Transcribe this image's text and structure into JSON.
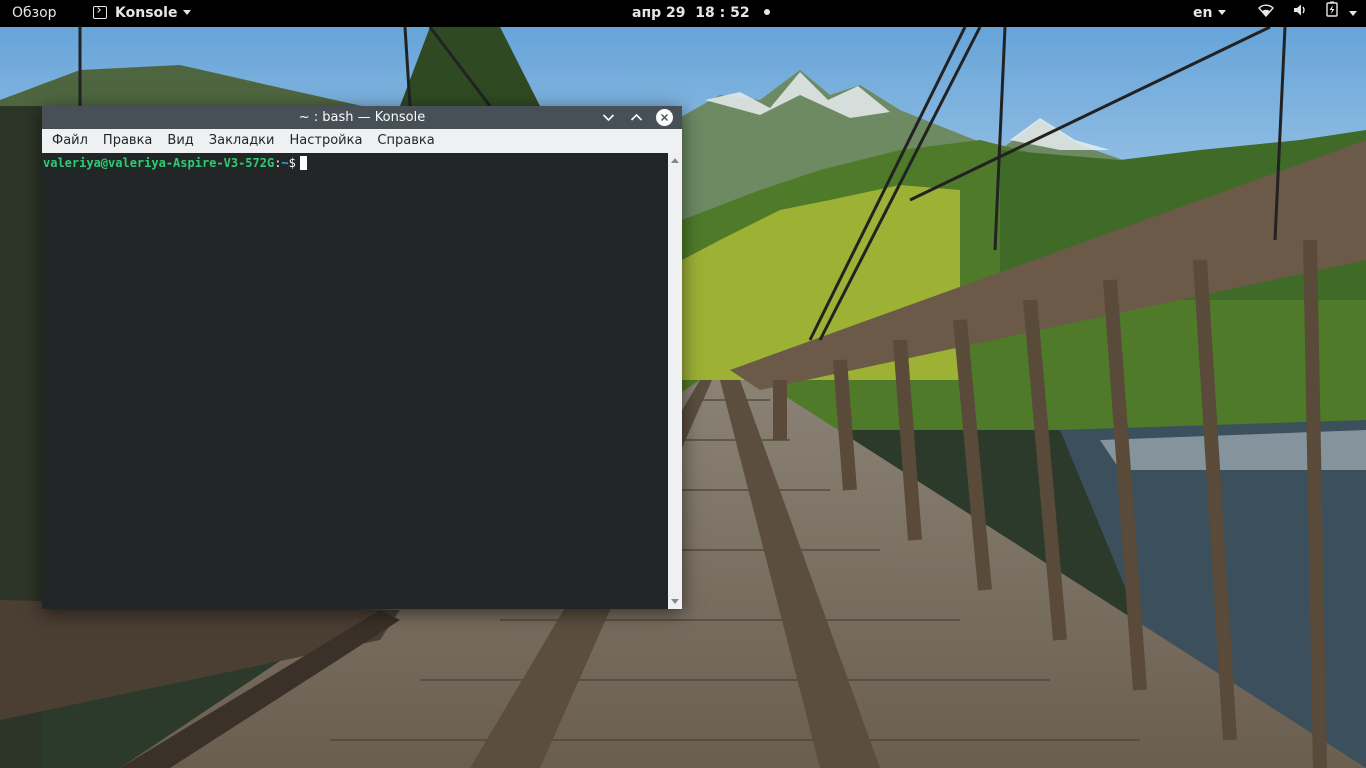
{
  "topbar": {
    "activities": "Обзор",
    "app_name": "Konsole",
    "clock": "апр 29  18 : 52",
    "language": "en",
    "icons": [
      "terminal-icon",
      "wifi-icon",
      "volume-icon",
      "battery-charging-icon"
    ]
  },
  "konsole": {
    "title": "~ : bash — Konsole",
    "menu": [
      "Файл",
      "Правка",
      "Вид",
      "Закладки",
      "Настройка",
      "Справка"
    ],
    "prompt_user": "valeriya@valeriya-Aspire-V3-572G",
    "prompt_sep": ":",
    "prompt_dir": "~",
    "prompt_symbol": "$"
  },
  "colors": {
    "topbar_bg": "#000000",
    "titlebar_bg": "#475057",
    "terminal_bg": "#232627",
    "prompt_user": "#2ecc71",
    "prompt_dir": "#3daee9"
  }
}
